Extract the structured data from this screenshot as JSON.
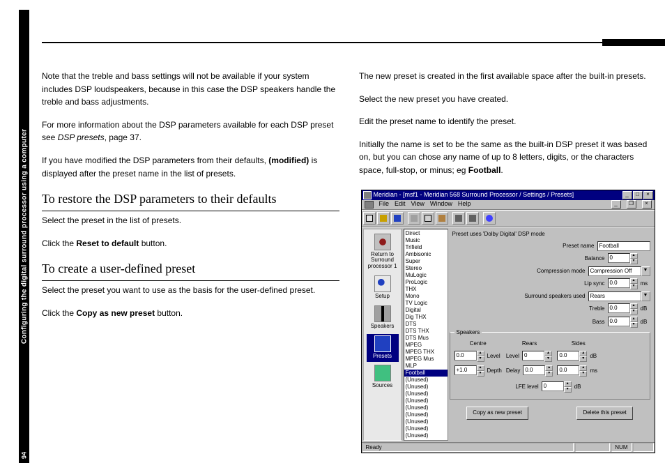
{
  "sidebar_title": "Configuring the digital surround processor using a computer",
  "page_number": "94",
  "col1": {
    "p1": "Note that the treble and bass settings will not be available if your system includes DSP loudspeakers, because in this case the DSP speakers handle the treble and bass adjustments.",
    "p2a": "For more information about the DSP parameters available for each DSP preset see ",
    "p2i": "DSP presets",
    "p2b": ", page 37.",
    "p3a": "If you have modified the DSP parameters from their defaults, ",
    "p3b": "(modified)",
    "p3c": " is displayed after the preset name in the list of presets.",
    "h1": "To restore the DSP parameters to their defaults",
    "h1_s1": "Select the preset in the list of presets.",
    "h1_s2a": "Click the ",
    "h1_s2b": "Reset to default",
    "h1_s2c": " button.",
    "h2": "To create a user-defined preset",
    "h2_s1": "Select the preset you want to use as the basis for the user-defined preset.",
    "h2_s2a": "Click the ",
    "h2_s2b": "Copy as new preset",
    "h2_s2c": " button."
  },
  "col2": {
    "p1": "The new preset is created in the first available space after the built-in presets.",
    "s1": "Select the new preset you have created.",
    "s2": "Edit the preset name to identify the preset.",
    "p2a": "Initially the name is set to be the same as the built-in DSP preset it was based on, but you can chose any name of up to 8 letters, digits, or the characters space, full-stop, or minus; eg ",
    "p2b": "Football",
    "p2c": "."
  },
  "app": {
    "title": "Meridian - [msf1 - Meridian 568 Surround Processor / Settings / Presets]",
    "menus": [
      "File",
      "Edit",
      "View",
      "Window",
      "Help"
    ],
    "sidebar": {
      "return": "Return to Surround processor 1",
      "setup": "Setup",
      "speakers": "Speakers",
      "presets": "Presets",
      "sources": "Sources"
    },
    "presets": [
      "Direct",
      "Music",
      "Trifield",
      "Ambisonic",
      "Super",
      "Stereo",
      "MuLogic",
      "ProLogic",
      "THX",
      "Mono",
      "TV Logic",
      "Digital",
      "Dig THX",
      "DTS",
      "DTS THX",
      "DTS Mus",
      "MPEG",
      "MPEG THX",
      "MPEG Mus",
      "MLP",
      "Football",
      "(Unused)",
      "(Unused)",
      "(Unused)",
      "(Unused)",
      "(Unused)",
      "(Unused)",
      "(Unused)",
      "(Unused)",
      "(Unused)"
    ],
    "preset_selected_index": 20,
    "mode_text": "Preset uses 'Dolby Digital' DSP mode",
    "labels": {
      "preset_name": "Preset name",
      "balance": "Balance",
      "compression": "Compression mode",
      "lipsync": "Lip sync",
      "surround_used": "Surround speakers used",
      "treble": "Treble",
      "bass": "Bass",
      "speakers_group": "Speakers",
      "centre": "Centre",
      "rears": "Rears",
      "sides": "Sides",
      "level": "Level",
      "depth": "Depth",
      "delay": "Delay",
      "lfe": "LFE level",
      "copy_btn": "Copy as new preset",
      "delete_btn": "Delete this preset",
      "ready": "Ready",
      "num": "NUM"
    },
    "values": {
      "preset_name": "Football",
      "balance": "0",
      "compression": "Compression Off",
      "lipsync": "0.0",
      "lipsync_unit": "ms",
      "surround_used": "Rears",
      "treble": "0.0",
      "treble_unit": "dB",
      "bass": "0.0",
      "bass_unit": "dB",
      "centre_level": "0.0",
      "centre_depth": "+1.0",
      "rears_level": "0",
      "rears_delay": "0.0",
      "sides_level": "0.0",
      "sides_delay": "0.0",
      "level_unit": "dB",
      "delay_unit": "ms",
      "lfe": "0"
    }
  }
}
